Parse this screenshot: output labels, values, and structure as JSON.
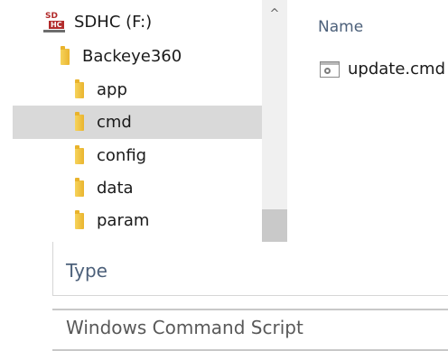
{
  "nav_tree": {
    "drive": {
      "label": "SDHC (F:)",
      "icon": "sdhc-drive-icon",
      "icon_text_top": "SD",
      "icon_text_bottom": "HC"
    },
    "root_folder": {
      "label": "Backeye360",
      "icon": "folder-icon"
    },
    "subfolders": [
      {
        "label": "app",
        "selected": false
      },
      {
        "label": "cmd",
        "selected": true
      },
      {
        "label": "config",
        "selected": false
      },
      {
        "label": "data",
        "selected": false
      },
      {
        "label": "param",
        "selected": false
      }
    ],
    "scroll_up_glyph": "^"
  },
  "file_list": {
    "column_header": "Name",
    "files": [
      {
        "name": "update.cmd",
        "icon": "cmd-file-icon"
      }
    ]
  },
  "details": {
    "type_header": "Type",
    "type_value": "Windows Command Script"
  },
  "colors": {
    "selection": "#d9d9d9",
    "header_text": "#4c607a",
    "folder": "#eab530",
    "drive_accent": "#b22b2b"
  }
}
